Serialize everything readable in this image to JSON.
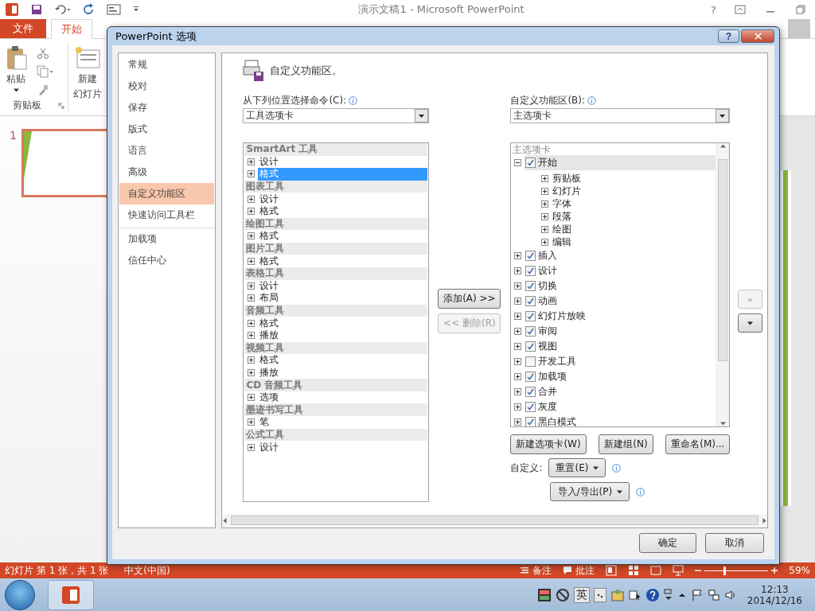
{
  "app": {
    "title": "演示文稿1 - Microsoft PowerPoint",
    "help": "?",
    "tabs": [
      {
        "label": "文件",
        "kind": "file",
        "selected": false
      },
      {
        "label": "开始",
        "kind": "tab",
        "selected": true
      }
    ],
    "ribbon": {
      "paste": "粘贴",
      "new_slide_lines": [
        "新建",
        "幻灯片"
      ],
      "group": "剪贴板"
    },
    "slide_number": "1",
    "status": {
      "slide": "幻灯片 第 1 张，共 1 张",
      "language": "中文(中国)",
      "notes": "备注",
      "comments": "批注",
      "zoom": "59%",
      "zoom_slider": {
        "level": 0.3
      }
    },
    "taskbar": {
      "ime": "英",
      "time": "12:13",
      "date": "2014/12/16"
    }
  },
  "dialog": {
    "title": "PowerPoint 选项",
    "help": "?",
    "nav": [
      {
        "label": "常规",
        "selected": false,
        "divider_before": false
      },
      {
        "label": "校对",
        "selected": false,
        "divider_before": false
      },
      {
        "label": "保存",
        "selected": false,
        "divider_before": false
      },
      {
        "label": "版式",
        "selected": false,
        "divider_before": false
      },
      {
        "label": "语言",
        "selected": false,
        "divider_before": false
      },
      {
        "label": "高级",
        "selected": false,
        "divider_before": false
      },
      {
        "label": "自定义功能区",
        "selected": true,
        "divider_before": false
      },
      {
        "label": "快速访问工具栏",
        "selected": false,
        "divider_before": false
      },
      {
        "label": "加载项",
        "selected": false,
        "divider_before": true
      },
      {
        "label": "信任中心",
        "selected": false,
        "divider_before": false
      }
    ],
    "heading": "自定义功能区。",
    "commands_label": "从下列位置选择命令(C):",
    "commands_select": "工具选项卡",
    "ribbon_label": "自定义功能区(B):",
    "ribbon_select": "主选项卡",
    "commands": [
      {
        "group": "SmartArt 工具",
        "items": [
          {
            "label": "设计",
            "selected": false
          },
          {
            "label": "格式",
            "selected": true
          }
        ]
      },
      {
        "group": "图表工具",
        "items": [
          {
            "label": "设计",
            "selected": false
          },
          {
            "label": "格式",
            "selected": false
          }
        ]
      },
      {
        "group": "绘图工具",
        "items": [
          {
            "label": "格式",
            "selected": false
          }
        ]
      },
      {
        "group": "图片工具",
        "items": [
          {
            "label": "格式",
            "selected": false
          }
        ]
      },
      {
        "group": "表格工具",
        "items": [
          {
            "label": "设计",
            "selected": false
          },
          {
            "label": "布局",
            "selected": false
          }
        ]
      },
      {
        "group": "音频工具",
        "items": [
          {
            "label": "格式",
            "selected": false
          },
          {
            "label": "播放",
            "selected": false
          }
        ]
      },
      {
        "group": "视频工具",
        "items": [
          {
            "label": "格式",
            "selected": false
          },
          {
            "label": "播放",
            "selected": false
          }
        ]
      },
      {
        "group": "CD 音频工具",
        "items": [
          {
            "label": "选项",
            "selected": false
          }
        ]
      },
      {
        "group": "墨迹书写工具",
        "items": [
          {
            "label": "笔",
            "selected": false
          }
        ]
      },
      {
        "group": "公式工具",
        "items": [
          {
            "label": "设计",
            "selected": false
          }
        ]
      }
    ],
    "tree": {
      "header": "主选项卡",
      "tabs": [
        {
          "label": "开始",
          "checked": true,
          "expanded": true,
          "selected": true,
          "children": [
            {
              "label": "剪贴板"
            },
            {
              "label": "幻灯片"
            },
            {
              "label": "字体"
            },
            {
              "label": "段落"
            },
            {
              "label": "绘图"
            },
            {
              "label": "编辑"
            }
          ]
        },
        {
          "label": "插入",
          "checked": true,
          "expanded": false,
          "selected": false
        },
        {
          "label": "设计",
          "checked": true,
          "expanded": false,
          "selected": false
        },
        {
          "label": "切换",
          "checked": true,
          "expanded": false,
          "selected": false
        },
        {
          "label": "动画",
          "checked": true,
          "expanded": false,
          "selected": false
        },
        {
          "label": "幻灯片放映",
          "checked": true,
          "expanded": false,
          "selected": false
        },
        {
          "label": "审阅",
          "checked": true,
          "expanded": false,
          "selected": false
        },
        {
          "label": "视图",
          "checked": true,
          "expanded": false,
          "selected": false
        },
        {
          "label": "开发工具",
          "checked": false,
          "expanded": false,
          "selected": false
        },
        {
          "label": "加载项",
          "checked": true,
          "expanded": false,
          "selected": false
        },
        {
          "label": "合并",
          "checked": true,
          "expanded": false,
          "selected": false
        },
        {
          "label": "灰度",
          "checked": true,
          "expanded": false,
          "selected": false
        },
        {
          "label": "黑白模式",
          "checked": true,
          "expanded": false,
          "selected": false
        }
      ]
    },
    "add_button": {
      "label": "添加(A) >>",
      "disabled": false
    },
    "remove_button": {
      "label": "<< 删除(R)",
      "disabled": true
    },
    "move_up": {
      "disabled": true
    },
    "move_down": {
      "disabled": false
    },
    "tree_buttons": [
      "新建选项卡(W)",
      "新建组(N)",
      "重命名(M)..."
    ],
    "customize_label": "自定义:",
    "reset": "重置(E)",
    "import_export": "导入/导出(P)",
    "ok": "确定",
    "cancel": "取消"
  }
}
